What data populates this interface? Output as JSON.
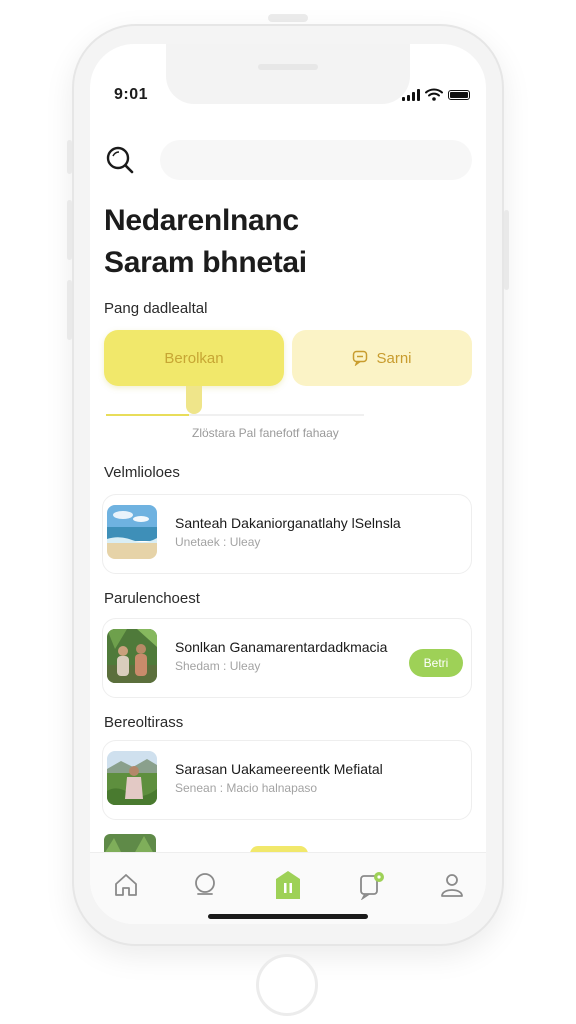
{
  "status": {
    "time": "9:01"
  },
  "search": {
    "placeholder": ""
  },
  "title": {
    "line1": "Nedarenlnanc",
    "line2": "Saram bhnetai"
  },
  "actions": {
    "section_label": "Pang dadlealtal",
    "primary_label": "Berolkan",
    "secondary_label": "Sarni",
    "progress": 0.32,
    "hint": "Zlöstara Pal fanefotf fahaay"
  },
  "sections": [
    {
      "label": "Velmlioloes",
      "item": {
        "title": "Santeah Dakaniorganatlahy lSelnsla",
        "subtitle": "Unetaek : Uleay",
        "thumb": "beach-thumbnail"
      }
    },
    {
      "label": "Parulenchoest",
      "item": {
        "title": "Sonlkan Ganamarentardadkmacia",
        "subtitle": "Shedam : Uleay",
        "thumb": "people-palms-thumbnail",
        "pill": "Betri"
      }
    },
    {
      "label": "Bereoltirass",
      "item": {
        "title": "Sarasan Uakameereentk Mefiatal",
        "subtitle": "Senean : Macio halnapaso",
        "thumb": "woman-field-thumbnail"
      }
    }
  ],
  "tabbar": {
    "items": [
      "home-icon",
      "chat-bubble-icon",
      "active-tab-icon",
      "notification-icon",
      "profile-icon"
    ],
    "active_index": 2,
    "accent": "#9ed157"
  },
  "colors": {
    "primary_yellow": "#f1e86b",
    "secondary_yellow": "#fbf3c6",
    "green": "#9ed157"
  }
}
